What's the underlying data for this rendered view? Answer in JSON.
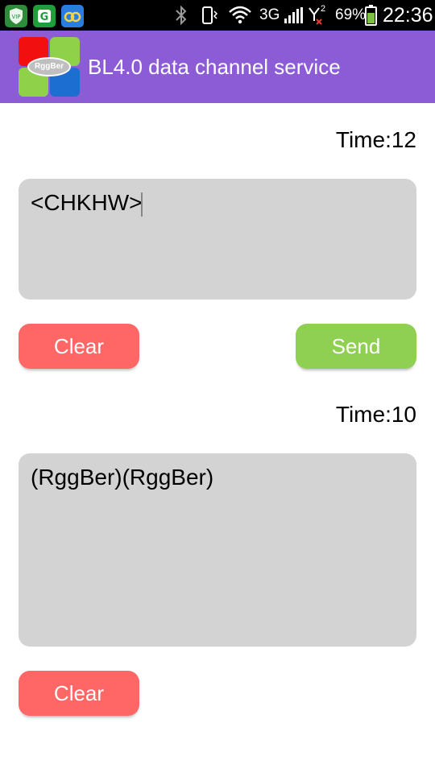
{
  "status_bar": {
    "app_icons": [
      "vip-shield-icon",
      "c-app-icon",
      "infinity-app-icon"
    ],
    "network_label": "3G",
    "sim_label": "2",
    "battery_percent": "69%",
    "time": "22:36"
  },
  "action_bar": {
    "logo_text": "RggBer",
    "title": "BL4.0 data channel service"
  },
  "send_section": {
    "time_label": "Time:12",
    "input_text": "<CHKHW>",
    "clear_label": "Clear",
    "send_label": "Send"
  },
  "receive_section": {
    "time_label": "Time:10",
    "output_text": "(RggBer)(RggBer)",
    "clear_label": "Clear"
  },
  "colors": {
    "action_bar": "#8c5cd6",
    "clear_button": "#ff6666",
    "send_button": "#8fcf52",
    "text_box": "#d3d3d3"
  }
}
